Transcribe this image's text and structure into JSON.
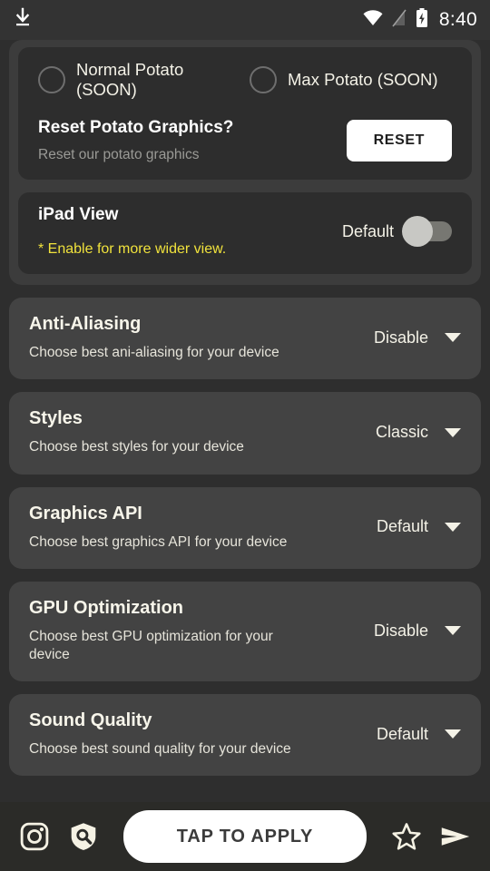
{
  "statusbar": {
    "time": "8:40",
    "icons": [
      "download-icon",
      "wifi-icon",
      "signal-off-icon",
      "battery-charging-icon"
    ]
  },
  "potato_group": {
    "radio_options": [
      {
        "label": "Normal Potato (SOON)",
        "selected": false
      },
      {
        "label": "Max Potato (SOON)",
        "selected": false
      }
    ],
    "reset": {
      "title": "Reset Potato  Graphics?",
      "subtitle": "Reset our potato graphics",
      "button_label": "RESET"
    },
    "ipad_view": {
      "title": "iPad View",
      "subtitle": "* Enable for more wider view.",
      "subtitle_color": "#f0e23c",
      "toggle_label": "Default",
      "toggle_on": false
    }
  },
  "settings": [
    {
      "title": "Anti-Aliasing",
      "subtitle": "Choose best ani-aliasing for your device",
      "value": "Disable"
    },
    {
      "title": "Styles",
      "subtitle": "Choose best styles for your device",
      "value": "Classic"
    },
    {
      "title": "Graphics API",
      "subtitle": "Choose best graphics API for your device",
      "value": "Default"
    },
    {
      "title": "GPU Optimization",
      "subtitle": "Choose best GPU optimization for your device",
      "value": "Disable"
    },
    {
      "title": "Sound Quality",
      "subtitle": "Choose best sound quality for your device",
      "value": "Default"
    }
  ],
  "bottombar": {
    "apply_label": "TAP TO APPLY",
    "left_icons": [
      "instagram-icon",
      "shield-search-icon"
    ],
    "right_icons": [
      "star-icon",
      "send-icon"
    ]
  },
  "colors": {
    "page_background": "#2e2e2e",
    "group_background": "#3c3c3c",
    "inner_card_background": "#2d2d2d",
    "setting_card_background": "#434343",
    "accent_text": "#f4f2e7",
    "warning_yellow": "#f0e23c",
    "button_white": "#ffffff"
  }
}
